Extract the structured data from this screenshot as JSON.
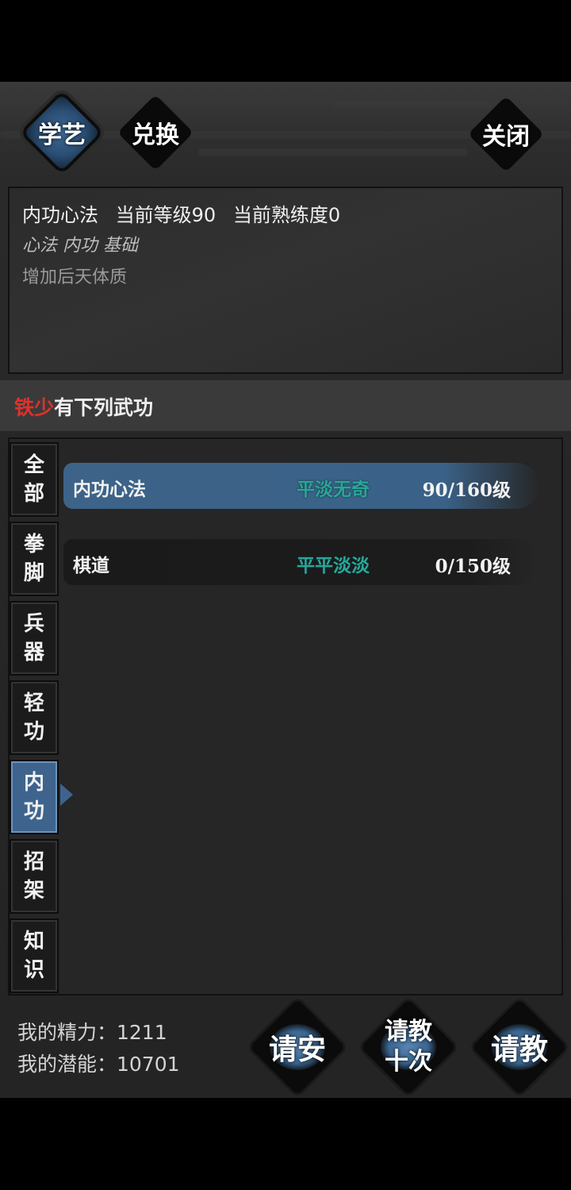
{
  "header": {
    "tab_learn": "学艺",
    "tab_exchange": "兑换",
    "close": "关闭"
  },
  "info": {
    "skill_name": "内功心法",
    "current_level": "当前等级90",
    "current_proficiency": "当前熟练度0",
    "tags": "心法 内功 基础",
    "effect": "增加后天体质"
  },
  "list_title": {
    "npc": "铁少",
    "suffix": "有下列武功"
  },
  "categories": [
    {
      "l1": "全",
      "l2": "部"
    },
    {
      "l1": "拳",
      "l2": "脚"
    },
    {
      "l1": "兵",
      "l2": "器"
    },
    {
      "l1": "轻",
      "l2": "功"
    },
    {
      "l1": "内",
      "l2": "功"
    },
    {
      "l1": "招",
      "l2": "架"
    },
    {
      "l1": "知",
      "l2": "识"
    }
  ],
  "active_category": "内功",
  "skills": [
    {
      "name": "内功心法",
      "quality": "平淡无奇",
      "level": "90/160级"
    },
    {
      "name": "棋道",
      "quality": "平平淡淡",
      "level": "0/150级"
    }
  ],
  "stats": {
    "energy": "我的精力：1211",
    "potential": "我的潜能：10701"
  },
  "actions": {
    "greet": "请安",
    "ask_ten_l1": "请教",
    "ask_ten_l2": "十次",
    "ask": "请教"
  },
  "colors": {
    "accent_blue": "#3e648e",
    "quality_green": "#2aa59a",
    "npc_red": "#e0312b"
  }
}
